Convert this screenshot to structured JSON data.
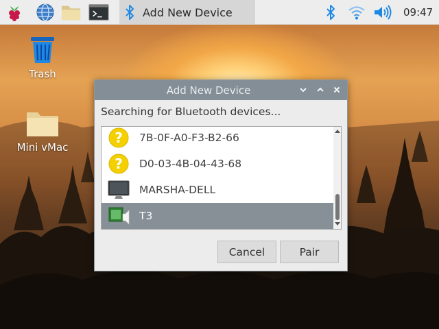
{
  "taskbar": {
    "launchers": [
      {
        "icon": "raspberry-menu-icon"
      },
      {
        "icon": "web-browser-icon"
      },
      {
        "icon": "file-manager-icon"
      },
      {
        "icon": "terminal-icon"
      }
    ],
    "task": {
      "icon": "bluetooth-icon",
      "label": "Add New Device"
    },
    "tray": {
      "bluetooth": "bluetooth-icon",
      "wifi": "wifi-icon",
      "volume": "volume-icon"
    },
    "clock": "09:47"
  },
  "desktop": {
    "icons": [
      {
        "icon": "trash-icon",
        "label": "Trash"
      },
      {
        "icon": "folder-icon",
        "label": "Mini vMac"
      }
    ]
  },
  "dialog": {
    "title": "Add New Device",
    "controls": [
      "minimize",
      "maximize",
      "close"
    ],
    "status": "Searching for Bluetooth devices...",
    "devices": [
      {
        "name": "7B-0F-A0-F3-B2-66",
        "icon": "unknown-device-icon",
        "selected": false
      },
      {
        "name": "D0-03-4B-04-43-68",
        "icon": "unknown-device-icon",
        "selected": false
      },
      {
        "name": "MARSHA-DELL",
        "icon": "computer-icon",
        "selected": false
      },
      {
        "name": "T3",
        "icon": "audio-device-icon",
        "selected": true
      }
    ],
    "buttons": {
      "cancel": "Cancel",
      "pair": "Pair"
    }
  },
  "colors": {
    "titlebar": "#838e96",
    "selection": "#878f97",
    "accent_blue": "#1e88e5"
  }
}
